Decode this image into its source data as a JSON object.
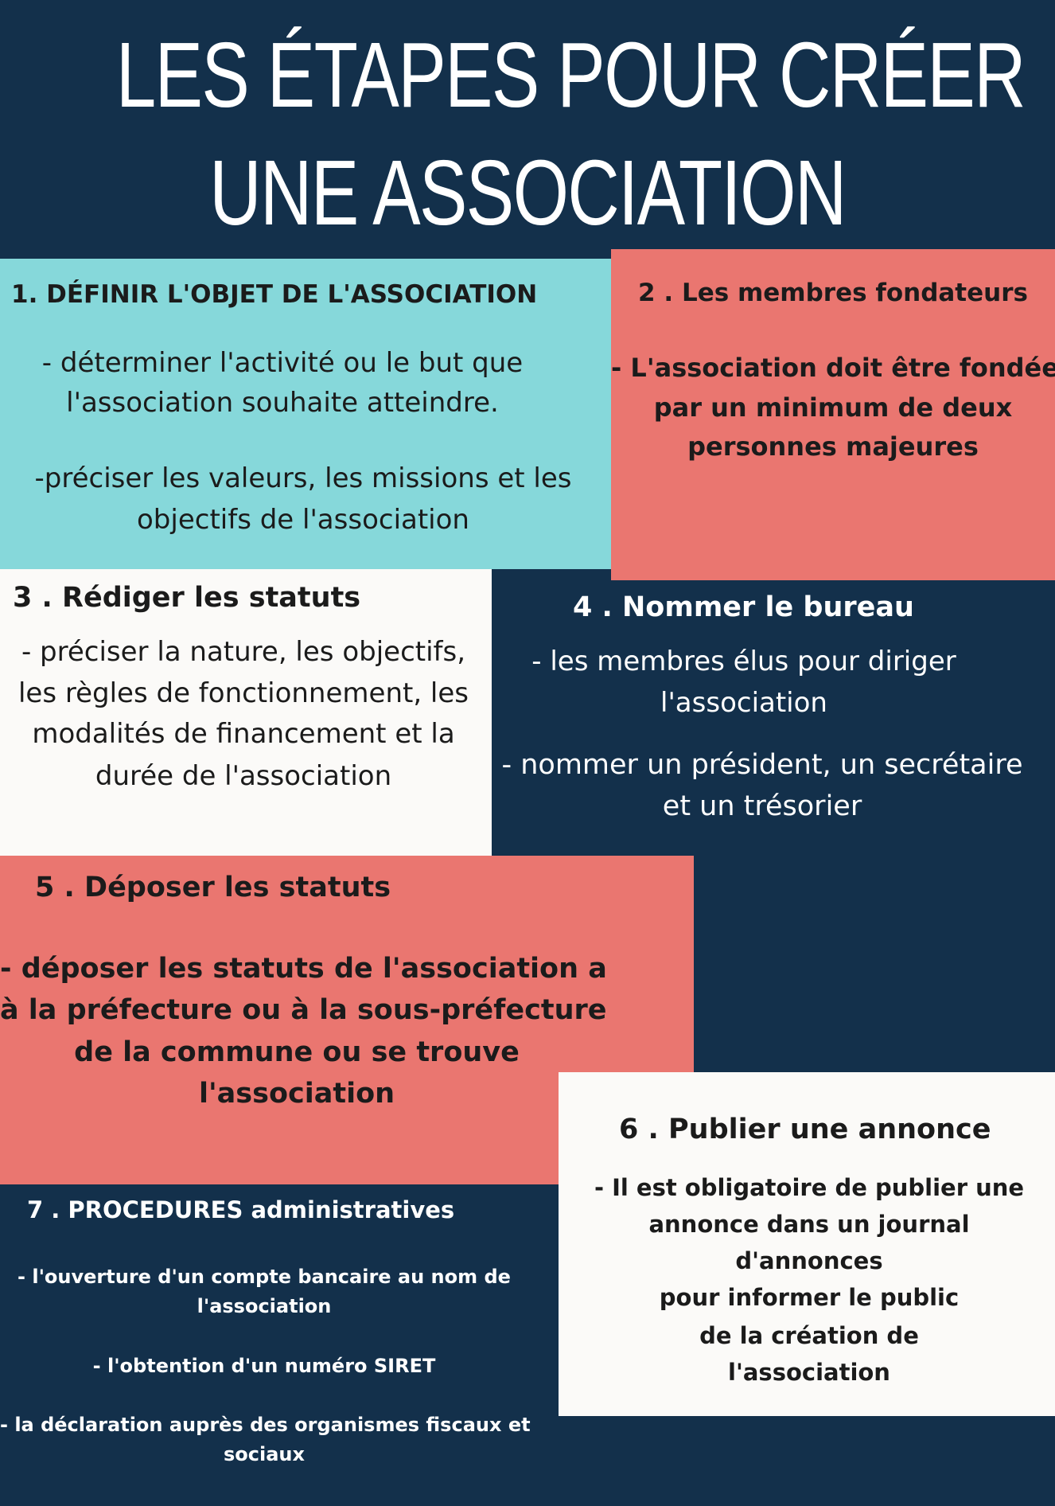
{
  "title": {
    "line1": "LES ÉTAPES POUR CRÉER",
    "line2": "UNE ASSOCIATION"
  },
  "step1": {
    "heading": "1. DÉFINIR L'OBJET DE L'ASSOCIATION",
    "lines": [
      "- déterminer l'activité ou le but que",
      "l'association souhaite atteindre.",
      "-préciser les valeurs, les missions et les",
      "objectifs de l'association"
    ]
  },
  "step2": {
    "heading": "2 . Les membres fondateurs",
    "lines": [
      "- L'association doit être fondée",
      "par un minimum de deux",
      "personnes majeures"
    ]
  },
  "step3": {
    "heading": "3 . Rédiger les statuts",
    "lines": [
      "- préciser la nature, les objectifs,",
      "les règles de fonctionnement, les",
      "modalités de financement et la",
      "durée de l'association"
    ]
  },
  "step4": {
    "heading": "4 . Nommer le bureau",
    "lines": [
      "- les membres élus pour diriger",
      "l'association",
      "- nommer un président, un secrétaire",
      "et un trésorier"
    ]
  },
  "step5": {
    "heading": "5 . Déposer les statuts",
    "lines": [
      "- déposer les statuts de l'association a",
      "à la préfecture ou à la sous-préfecture",
      "de la commune ou se trouve",
      "l'association"
    ]
  },
  "step6": {
    "heading": "6 . Publier une annonce",
    "lines": [
      "- Il est obligatoire de publier une",
      "annonce dans un journal",
      "d'annonces",
      "pour informer le public",
      "de la création de",
      "l'association"
    ]
  },
  "step7": {
    "heading": "7 . PROCEDURES administratives",
    "lines": [
      "- l'ouverture d'un compte bancaire au nom de",
      "l'association",
      "- l'obtention d'un numéro SIRET",
      "- la déclaration auprès des organismes fiscaux et",
      "sociaux"
    ]
  },
  "colors": {
    "navy": "#13304b",
    "teal": "#86d8da",
    "coral": "#ea7670",
    "offwhite": "#fbfaf8"
  }
}
